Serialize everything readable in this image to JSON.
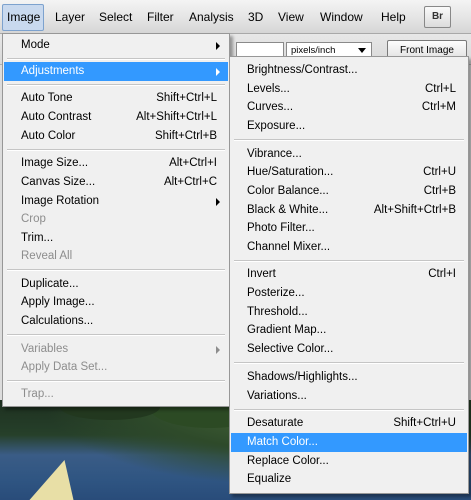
{
  "menubar": {
    "items": [
      "Image",
      "Layer",
      "Select",
      "Filter",
      "Analysis",
      "3D",
      "View",
      "Window",
      "Help"
    ],
    "br_label": "Br"
  },
  "options": {
    "resolution_unit": "pixels/inch",
    "front_image_label": "Front Image"
  },
  "image_menu": {
    "mode": "Mode",
    "adjustments": "Adjustments",
    "auto_tone": "Auto Tone",
    "auto_tone_sc": "Shift+Ctrl+L",
    "auto_contrast": "Auto Contrast",
    "auto_contrast_sc": "Alt+Shift+Ctrl+L",
    "auto_color": "Auto Color",
    "auto_color_sc": "Shift+Ctrl+B",
    "image_size": "Image Size...",
    "image_size_sc": "Alt+Ctrl+I",
    "canvas_size": "Canvas Size...",
    "canvas_size_sc": "Alt+Ctrl+C",
    "image_rotation": "Image Rotation",
    "crop": "Crop",
    "trim": "Trim...",
    "reveal_all": "Reveal All",
    "duplicate": "Duplicate...",
    "apply_image": "Apply Image...",
    "calculations": "Calculations...",
    "variables": "Variables",
    "apply_data_set": "Apply Data Set...",
    "trap": "Trap..."
  },
  "adjustments_menu": {
    "brightness_contrast": "Brightness/Contrast...",
    "levels": "Levels...",
    "levels_sc": "Ctrl+L",
    "curves": "Curves...",
    "curves_sc": "Ctrl+M",
    "exposure": "Exposure...",
    "vibrance": "Vibrance...",
    "hue_saturation": "Hue/Saturation...",
    "hue_saturation_sc": "Ctrl+U",
    "color_balance": "Color Balance...",
    "color_balance_sc": "Ctrl+B",
    "black_white": "Black & White...",
    "black_white_sc": "Alt+Shift+Ctrl+B",
    "photo_filter": "Photo Filter...",
    "channel_mixer": "Channel Mixer...",
    "invert": "Invert",
    "invert_sc": "Ctrl+I",
    "posterize": "Posterize...",
    "threshold": "Threshold...",
    "gradient_map": "Gradient Map...",
    "selective_color": "Selective Color...",
    "shadows_highlights": "Shadows/Highlights...",
    "variations": "Variations...",
    "desaturate": "Desaturate",
    "desaturate_sc": "Shift+Ctrl+U",
    "match_color": "Match Color...",
    "replace_color": "Replace Color...",
    "equalize": "Equalize"
  },
  "colors": {
    "highlight": "#3399ff",
    "menu_bg": "#f0f0f0",
    "disabled_text": "#8d8d8d"
  }
}
